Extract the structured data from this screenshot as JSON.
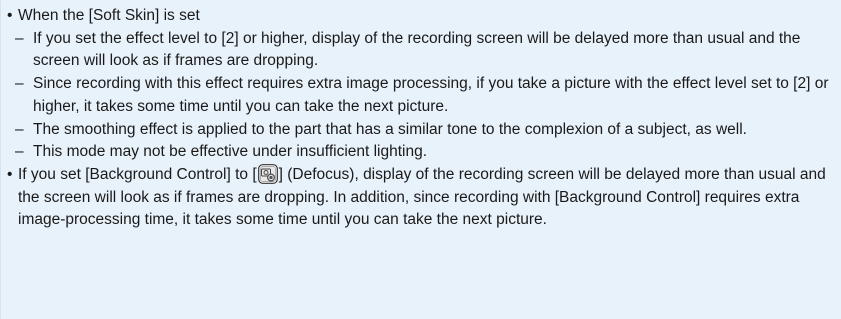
{
  "notes": {
    "bullet_symbol": "•",
    "dash_symbol": "–",
    "soft_skin": {
      "heading": "When the [Soft Skin] is set",
      "items": [
        "If you set the effect level to [2] or higher, display of the recording screen will be delayed more than usual and the screen will look as if frames are dropping.",
        "Since recording with this effect requires extra image processing, if you take a picture with the effect level set to [2] or higher, it takes some time until you can take the next picture.",
        "The smoothing effect is applied to the part that has a similar tone to the complexion of a subject, as well.",
        "This mode may not be effective under insufficient lighting."
      ]
    },
    "background_control": {
      "text_before": "If you set [Background Control] to [",
      "icon": "defocus-icon",
      "text_after": "] (Defocus), display of the recording screen will be delayed more than usual and the screen will look as if frames are dropping. In addition, since recording with [Background Control] requires extra image-processing time, it takes some time until you can take the next picture."
    }
  }
}
